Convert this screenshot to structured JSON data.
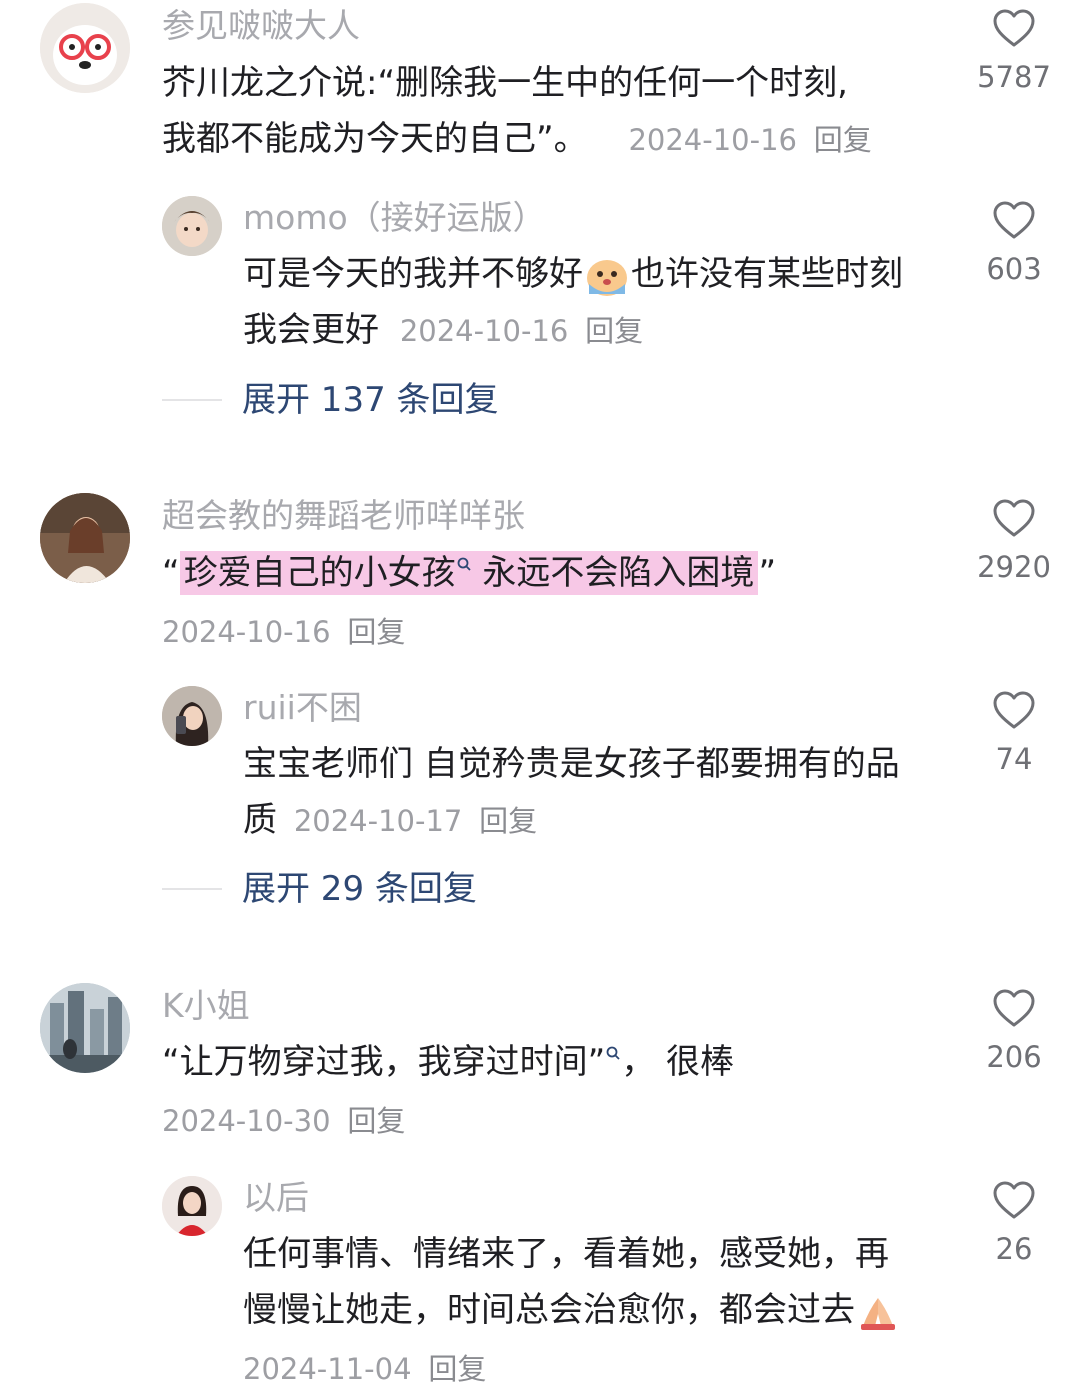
{
  "comments": [
    {
      "user": "参见啵啵大人",
      "text": "芥川龙之介说:“删除我一生中的任何一个时刻,",
      "text2": "我都不能成为今天的自己”。",
      "date": "2024-10-16",
      "reply": "回复",
      "likes": "5787",
      "avatar_icon": "dog-glasses-avatar",
      "replies": [
        {
          "user": "momo（接好运版）",
          "text": "可是今天的我并不够好",
          "text_after_emoji": "也许没有某些时刻",
          "text2": "我会更好",
          "emoji": "crying-emoji",
          "date": "2024-10-16",
          "reply": "回复",
          "likes": "603"
        }
      ],
      "expand": "展开 137 条回复"
    },
    {
      "user": "超会教的舞蹈老师咩咩张",
      "quote_open": "“",
      "highlight": "珍爱自己的小女孩",
      "highlight2": " 永远不会陷入困境",
      "quote_close": "”",
      "date": "2024-10-16",
      "reply": "回复",
      "likes": "2920",
      "replies": [
        {
          "user": "ruii不困",
          "text": "宝宝老师们 自觉矜贵是女孩子都要拥有的品",
          "text2": "质",
          "date": "2024-10-17",
          "reply": "回复",
          "likes": "74"
        }
      ],
      "expand": "展开 29 条回复"
    },
    {
      "user": "K小姐",
      "text_a": "“让万物穿过我，我穿过时间”",
      "text_b": "， 很棒",
      "date": "2024-10-30",
      "reply": "回复",
      "likes": "206",
      "replies": [
        {
          "user": "以后",
          "text": "任何事情、情绪来了，看着她，感受她，再",
          "text2": "慢慢让她走，时间总会治愈你，都会过去",
          "emoji": "pray-hands-emoji",
          "date": "2024-11-04",
          "reply": "回复",
          "likes": "26"
        }
      ]
    }
  ],
  "colors": {
    "username": "#a8a9ae",
    "expand": "#2d4773",
    "highlight": "#f7c8e6",
    "meta": "#9d9ea3"
  }
}
